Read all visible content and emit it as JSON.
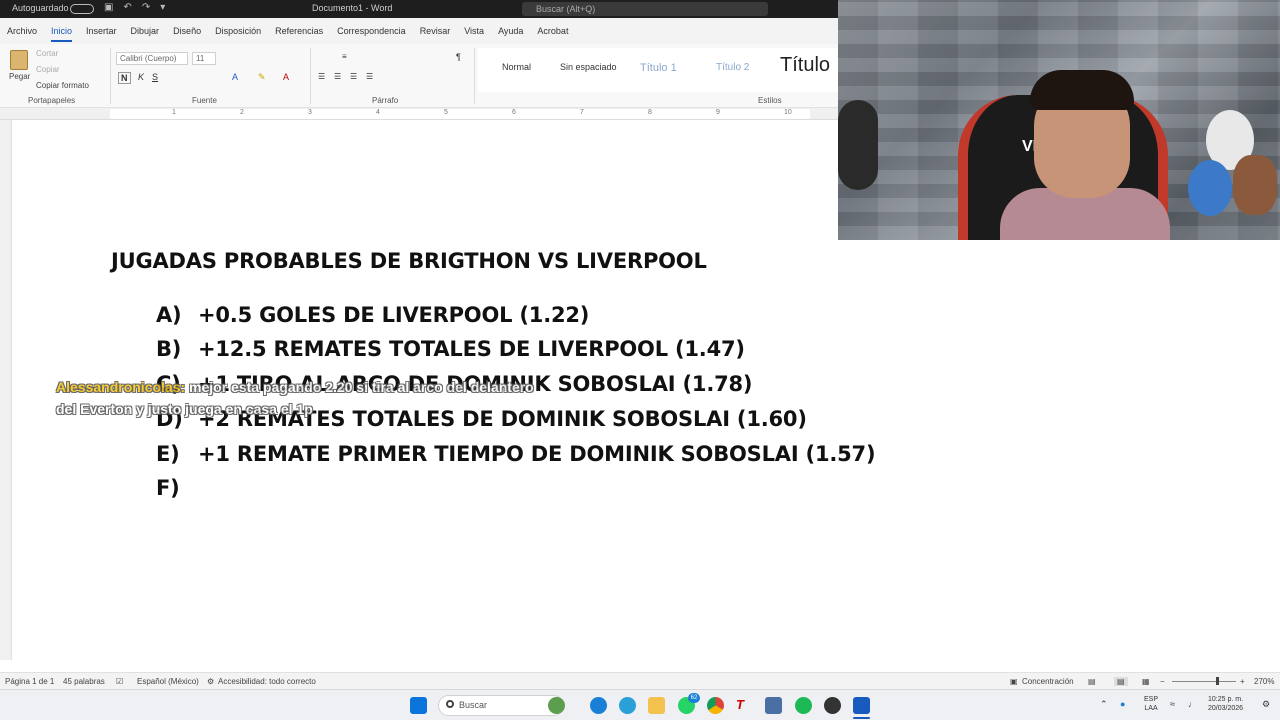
{
  "titlebar": {
    "autosave": "Autoguardado",
    "document": "Documento1 - Word",
    "search_placeholder": "Buscar (Alt+Q)"
  },
  "ribbon": {
    "tabs": [
      "Archivo",
      "Inicio",
      "Insertar",
      "Dibujar",
      "Diseño",
      "Disposición",
      "Referencias",
      "Correspondencia",
      "Revisar",
      "Vista",
      "Ayuda",
      "Acrobat"
    ],
    "active_tab": "Inicio",
    "clipboard": {
      "paste": "Pegar",
      "cut": "Cortar",
      "copy": "Copiar",
      "format_painter": "Copiar formato",
      "label": "Portapapeles"
    },
    "font": {
      "name": "Calibri (Cuerpo)",
      "size": "11",
      "label": "Fuente"
    },
    "paragraph": {
      "label": "Párrafo"
    },
    "styles": {
      "items": [
        "Normal",
        "Sin espaciado",
        "Título 1",
        "Título 2",
        "Título"
      ],
      "label": "Estilos"
    }
  },
  "ruler": [
    "1",
    "2",
    "3",
    "4",
    "5",
    "6",
    "7",
    "8",
    "9",
    "10"
  ],
  "document": {
    "title": "JUGADAS PROBABLES DE BRIGTHON VS LIVERPOOL",
    "items": [
      {
        "letter": "A)",
        "text": "+0.5 GOLES DE LIVERPOOL (1.22)"
      },
      {
        "letter": "B)",
        "text": "+12.5 REMATES TOTALES DE LIVERPOOL (1.47)"
      },
      {
        "letter": "C)",
        "text": "+1 TIRO AL ARCO DE DOMINIK SOBOSLAI (1.78)"
      },
      {
        "letter": "D)",
        "text": "+2 REMATES TOTALES DE DOMINIK SOBOSLAI (1.60)"
      },
      {
        "letter": "E)",
        "text": "+1 REMATE PRIMER TIEMPO DE DOMINIK SOBOSLAI (1.57)"
      },
      {
        "letter": "F)",
        "text": ""
      }
    ]
  },
  "chat": {
    "user": "Alessandronicolas:",
    "message": " mejor esta pagando 2.20 si tira al arco del delantero del Everton y justo juega en casa el 1p"
  },
  "webcam": {
    "chair_logo": "VI"
  },
  "statusbar": {
    "page": "Página 1 de 1",
    "words": "45 palabras",
    "language": "Español (México)",
    "accessibility": "Accesibilidad: todo correcto",
    "focus": "Concentración",
    "zoom": "270%"
  },
  "taskbar": {
    "search": "Buscar",
    "whatsapp_badge": "62",
    "lang": "ESP",
    "lang2": "LAA",
    "time": "10:25 p. m.",
    "date": "20/03/2026"
  },
  "colors": {
    "accent": "#185abd",
    "chat_user": "#f5c518",
    "title_bar": "#1e1e1e"
  }
}
